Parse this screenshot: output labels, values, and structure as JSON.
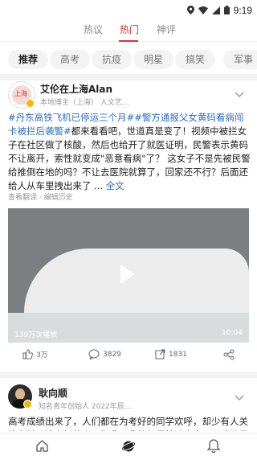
{
  "status": {
    "time": "9:19"
  },
  "tabs": [
    {
      "label": "热议"
    },
    {
      "label": "热门"
    },
    {
      "label": "神评"
    }
  ],
  "chips": [
    {
      "label": "推荐"
    },
    {
      "label": "高考"
    },
    {
      "label": "抗疫"
    },
    {
      "label": "明星"
    },
    {
      "label": "搞笑"
    },
    {
      "label": "军事"
    }
  ],
  "post1": {
    "avatar_text": "上海",
    "author": "艾伦在上海Alan",
    "author_desc": "本地博主（上海） 人文艺...",
    "hashtag1": "#丹东高铁飞机已停运三个月#",
    "hashtag2": "#警方通报父女黄码看病闯卡被拦后袭警#",
    "body": "都来看看吧，世道真是变了！视频中被拦女子在社区做了核酸，然后也给开了就医证明，民警表示黄码不让离开，索性就变成\"恶意看病\"了？ 这女子不是先被民警给推倒在地的吗？不让去医院就算了，回家还不行？后面还给人从车里拽出来了 ... ",
    "more": "全文",
    "translate": "查看翻译",
    "edit_history": "编辑历史",
    "video": {
      "plays": "139万次播放",
      "duration": "10:04"
    },
    "actions": {
      "likes": "3万",
      "comments": "3829",
      "shares": "1831"
    }
  },
  "post2": {
    "author": "耿向顺",
    "author_desc": "知名青年创始人 2022年辰...",
    "body": "高考成绩出来了，人们都在为考好的同学欢呼，却少有人关注和鼓励没考好的人，那我用我的经历鼓励大家，不论结果如何"
  }
}
